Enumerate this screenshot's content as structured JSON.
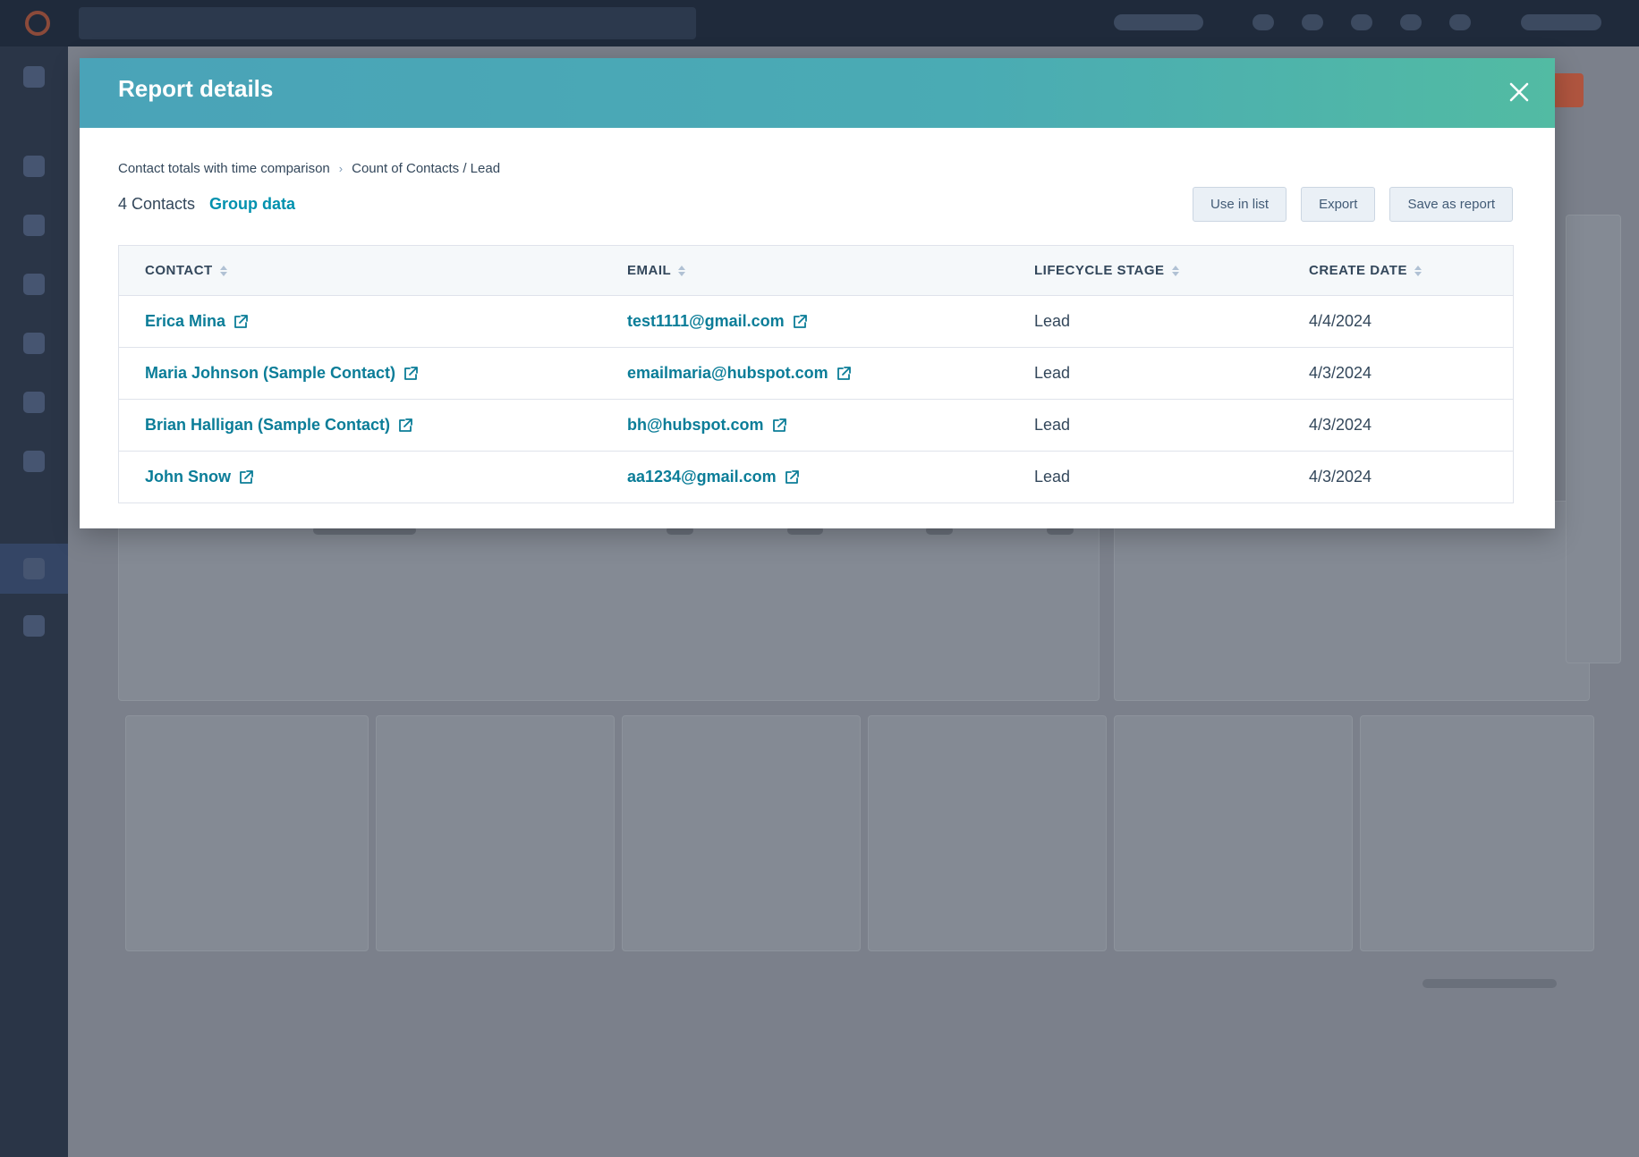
{
  "modal": {
    "title": "Report details",
    "breadcrumb": [
      "Contact totals with time comparison",
      "Count of Contacts / Lead"
    ],
    "count_label": "4 Contacts",
    "group_link": "Group data",
    "actions": {
      "use_in_list": "Use in list",
      "export": "Export",
      "save_as_report": "Save as report"
    }
  },
  "table": {
    "columns": [
      "CONTACT",
      "EMAIL",
      "LIFECYCLE STAGE",
      "CREATE DATE"
    ],
    "rows": [
      {
        "contact": "Erica Mina",
        "email": "test1111@gmail.com",
        "stage": "Lead",
        "date": "4/4/2024"
      },
      {
        "contact": "Maria Johnson (Sample Contact)",
        "email": "emailmaria@hubspot.com",
        "stage": "Lead",
        "date": "4/3/2024"
      },
      {
        "contact": "Brian Halligan (Sample Contact)",
        "email": "bh@hubspot.com",
        "stage": "Lead",
        "date": "4/3/2024"
      },
      {
        "contact": "John Snow",
        "email": "aa1234@gmail.com",
        "stage": "Lead",
        "date": "4/3/2024"
      }
    ]
  },
  "colors": {
    "header_gradient_start": "#4aa3b8",
    "header_gradient_end": "#52bba3",
    "link": "#0b7d98",
    "text": "#33475b",
    "overlay": "#7b808b"
  },
  "icons": {
    "close": "close-icon",
    "external_link": "external-link-icon",
    "sort": "sort-icon",
    "breadcrumb_separator": "chevron-right-icon"
  }
}
